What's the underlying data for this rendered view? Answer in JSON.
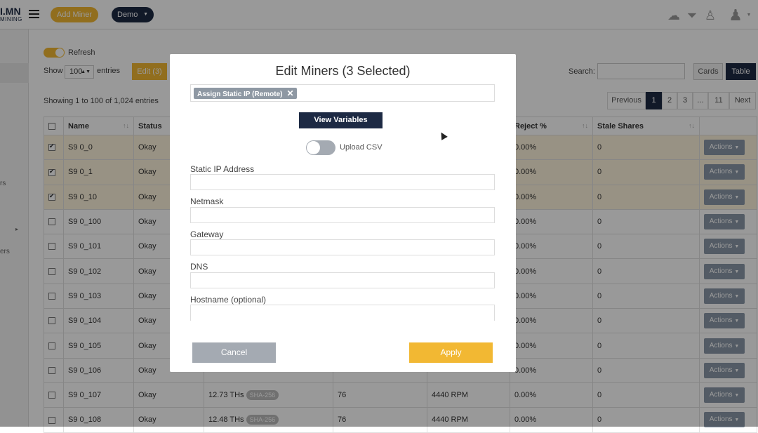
{
  "header": {
    "logo_top": "I.MN",
    "logo_bottom": "MINING",
    "add_miner": "Add Miner",
    "org_select": "Demo"
  },
  "leftnav": {
    "frag1": "rs",
    "frag2": "ers"
  },
  "controls": {
    "refresh_label": "Refresh",
    "show_label": "Show",
    "page_size": "100",
    "entries_label": "entries",
    "edit_button": "Edit (3)",
    "search_label": "Search:",
    "cards_button": "Cards",
    "table_button": "Table",
    "showing_text": "Showing 1 to 100 of 1,024 entries"
  },
  "pagination": [
    "Previous",
    "1",
    "2",
    "3",
    "...",
    "11",
    "Next"
  ],
  "table": {
    "headers": [
      "Name",
      "Status",
      "Reject %",
      "Stale Shares"
    ],
    "rows": [
      {
        "name": "S9 0_0",
        "status": "Okay",
        "hashrate": "",
        "algo": "",
        "temp": "",
        "fan": "",
        "reject": "0.00%",
        "stale": "0",
        "selected": true
      },
      {
        "name": "S9 0_1",
        "status": "Okay",
        "hashrate": "",
        "algo": "",
        "temp": "",
        "fan": "",
        "reject": "0.00%",
        "stale": "0",
        "selected": true
      },
      {
        "name": "S9 0_10",
        "status": "Okay",
        "hashrate": "",
        "algo": "",
        "temp": "",
        "fan": "",
        "reject": "0.00%",
        "stale": "0",
        "selected": true
      },
      {
        "name": "S9 0_100",
        "status": "Okay",
        "hashrate": "",
        "algo": "",
        "temp": "",
        "fan": "",
        "reject": "0.00%",
        "stale": "0",
        "selected": false
      },
      {
        "name": "S9 0_101",
        "status": "Okay",
        "hashrate": "",
        "algo": "",
        "temp": "",
        "fan": "",
        "reject": "0.00%",
        "stale": "0",
        "selected": false
      },
      {
        "name": "S9 0_102",
        "status": "Okay",
        "hashrate": "",
        "algo": "",
        "temp": "",
        "fan": "",
        "reject": "0.00%",
        "stale": "0",
        "selected": false
      },
      {
        "name": "S9 0_103",
        "status": "Okay",
        "hashrate": "",
        "algo": "",
        "temp": "",
        "fan": "",
        "reject": "0.00%",
        "stale": "0",
        "selected": false
      },
      {
        "name": "S9 0_104",
        "status": "Okay",
        "hashrate": "",
        "algo": "",
        "temp": "",
        "fan": "",
        "reject": "0.00%",
        "stale": "0",
        "selected": false
      },
      {
        "name": "S9 0_105",
        "status": "Okay",
        "hashrate": "",
        "algo": "",
        "temp": "",
        "fan": "",
        "reject": "0.00%",
        "stale": "0",
        "selected": false
      },
      {
        "name": "S9 0_106",
        "status": "Okay",
        "hashrate": "",
        "algo": "",
        "temp": "",
        "fan": "",
        "reject": "0.00%",
        "stale": "0",
        "selected": false
      },
      {
        "name": "S9 0_107",
        "status": "Okay",
        "hashrate": "12.73 THs",
        "algo": "SHA-256",
        "temp": "76",
        "fan": "4440 RPM",
        "reject": "0.00%",
        "stale": "0",
        "selected": false
      },
      {
        "name": "S9 0_108",
        "status": "Okay",
        "hashrate": "12.48 THs",
        "algo": "SHA-256",
        "temp": "76",
        "fan": "4440 RPM",
        "reject": "0.00%",
        "stale": "0",
        "selected": false
      }
    ],
    "actions_label": "Actions"
  },
  "modal": {
    "title": "Edit Miners (3 Selected)",
    "tag": "Assign Static IP (Remote)",
    "view_variables": "View Variables",
    "upload_csv": "Upload CSV",
    "fields": [
      {
        "label": "Static IP Address",
        "value": ""
      },
      {
        "label": "Netmask",
        "value": ""
      },
      {
        "label": "Gateway",
        "value": ""
      },
      {
        "label": "DNS",
        "value": ""
      },
      {
        "label": "Hostname (optional)",
        "value": ""
      }
    ],
    "cancel": "Cancel",
    "apply": "Apply"
  }
}
